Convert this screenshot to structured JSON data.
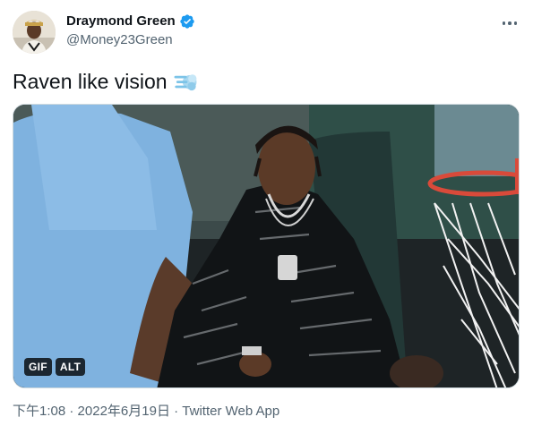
{
  "author": {
    "display_name": "Draymond Green",
    "handle": "@Money23Green",
    "verified": true,
    "avatar_icon": "avatar-photo"
  },
  "tweet": {
    "text": "Raven like vision",
    "emoji_icon": "dashing-away-emoji"
  },
  "media": {
    "type": "gif",
    "gif_badge": "GIF",
    "alt_badge": "ALT"
  },
  "meta": {
    "time": "下午1:08",
    "separator1": " · ",
    "date": "2022年6月19日",
    "separator2": " · ",
    "source": "Twitter Web App"
  },
  "colors": {
    "verified_blue": "#1d9bf0",
    "text_primary": "#0f1419",
    "text_secondary": "#536471",
    "emoji_blue": "#7cc4e8"
  }
}
